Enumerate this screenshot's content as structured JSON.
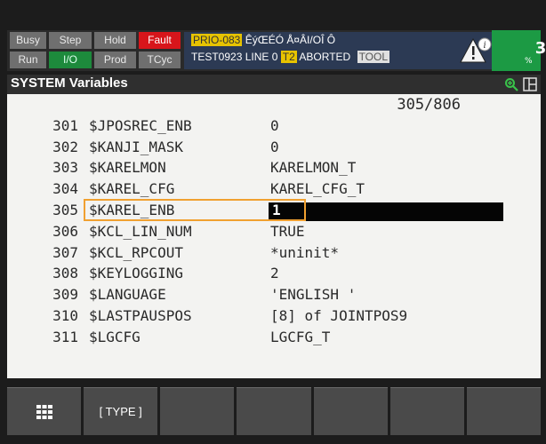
{
  "status": {
    "leds": [
      {
        "label": "Busy",
        "state": "gray"
      },
      {
        "label": "Step",
        "state": "gray"
      },
      {
        "label": "Hold",
        "state": "gray"
      },
      {
        "label": "Fault",
        "state": "red"
      },
      {
        "label": "Run",
        "state": "gray"
      },
      {
        "label": "I/O",
        "state": "green"
      },
      {
        "label": "Prod",
        "state": "gray"
      },
      {
        "label": "TCyc",
        "state": "gray"
      }
    ],
    "prio_tag": "PRIO-083",
    "prio_message": "ÊýŒÉÓ Å¤ÂI/OÎ  Ô",
    "program": "TEST0923 LINE 0",
    "mode": "T2",
    "state": "ABORTED",
    "tool": "TOOL",
    "counter": "3",
    "counter_unit": "%"
  },
  "title": "SYSTEM Variables",
  "page_indicator": "305/806",
  "rows": [
    {
      "num": "301",
      "name": "$JPOSREC_ENB",
      "value": "0"
    },
    {
      "num": "302",
      "name": "$KANJI_MASK",
      "value": "0"
    },
    {
      "num": "303",
      "name": "$KARELMON",
      "value": "KARELMON_T"
    },
    {
      "num": "304",
      "name": "$KAREL_CFG",
      "value": "KAREL_CFG_T"
    },
    {
      "num": "305",
      "name": "$KAREL_ENB",
      "value": "1"
    },
    {
      "num": "306",
      "name": "$KCL_LIN_NUM",
      "value": "TRUE"
    },
    {
      "num": "307",
      "name": "$KCL_RPCOUT",
      "value": "*uninit*"
    },
    {
      "num": "308",
      "name": "$KEYLOGGING",
      "value": "2"
    },
    {
      "num": "309",
      "name": "$LANGUAGE",
      "value": "'ENGLISH     '"
    },
    {
      "num": "310",
      "name": "$LASTPAUSPOS",
      "value": "[8] of JOINTPOS9"
    },
    {
      "num": "311",
      "name": "$LGCFG",
      "value": "LGCFG_T"
    }
  ],
  "selected_row": 4,
  "fkeys": [
    "",
    "[ TYPE ]",
    "",
    "",
    "",
    "",
    ""
  ],
  "colors": {
    "fault_red": "#d8151b",
    "io_green": "#1d8a3c",
    "highlight_orange": "#f0a030",
    "counter_green": "#1c9a44"
  }
}
